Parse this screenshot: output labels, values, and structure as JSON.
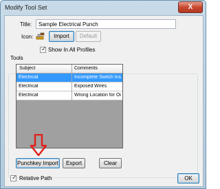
{
  "window": {
    "title": "Modify Tool Set",
    "close_glyph": "X"
  },
  "form": {
    "title_label": "Title:",
    "title_value": "Sample Electrical Punch",
    "icon_label": "Icon:",
    "import_label": "Import",
    "default_label": "Default",
    "show_profiles_label": "Show In All Profiles",
    "show_profiles_checked": true
  },
  "tools": {
    "group_label": "Tools",
    "columns": [
      "Subject",
      "Comments"
    ],
    "rows": [
      {
        "subject": "Electrical",
        "comments": "Incomplete Switch Inst...",
        "selected": true
      },
      {
        "subject": "Electrical",
        "comments": "Exposed Wires",
        "selected": false
      },
      {
        "subject": "Electrical",
        "comments": "Wrong Location for Ou...",
        "selected": false
      }
    ],
    "buttons": {
      "punchkey_import": "Punchkey Import",
      "export": "Export",
      "clear": "Clear"
    }
  },
  "footer": {
    "relative_path_label": "Relative Path",
    "relative_path_checked": true,
    "ok_label": "OK"
  },
  "icons": {
    "tool_icon": "wrench-hammer-icon",
    "annotation": "red-down-arrow-icon"
  },
  "colors": {
    "selection": "#3399ff",
    "annotation_arrow": "#e0201b"
  }
}
